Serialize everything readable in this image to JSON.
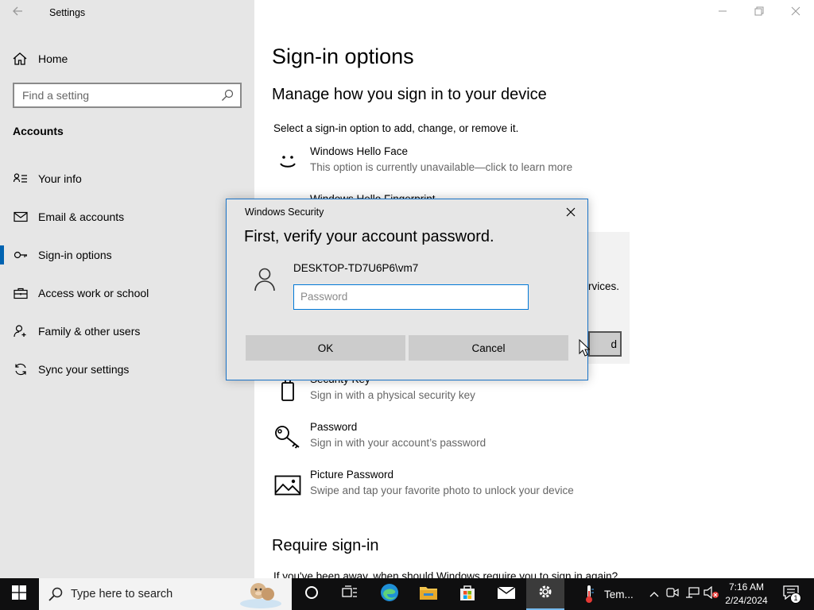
{
  "window": {
    "title": "Settings",
    "controls": {
      "minimize": "minimize",
      "maximize": "maximize",
      "close": "close"
    }
  },
  "sidebar": {
    "home_label": "Home",
    "search_placeholder": "Find a setting",
    "section_heading": "Accounts",
    "items": [
      {
        "label": "Your info",
        "icon": "person-list-icon",
        "active": false
      },
      {
        "label": "Email & accounts",
        "icon": "mail-icon",
        "active": false
      },
      {
        "label": "Sign-in options",
        "icon": "key-icon",
        "active": true
      },
      {
        "label": "Access work or school",
        "icon": "briefcase-icon",
        "active": false
      },
      {
        "label": "Family & other users",
        "icon": "add-person-icon",
        "active": false
      },
      {
        "label": "Sync your settings",
        "icon": "sync-icon",
        "active": false
      }
    ]
  },
  "main": {
    "page_title": "Sign-in options",
    "subtitle": "Manage how you sign in to your device",
    "description": "Select a sign-in option to add, change, or remove it.",
    "options": [
      {
        "title": "Windows Hello Face",
        "desc": "This option is currently unavailable—click to learn more",
        "icon": "smiley-icon"
      },
      {
        "title": "Windows Hello Fingerprint",
        "desc": "",
        "icon": "fingerprint-icon"
      },
      {
        "title": "Security Key",
        "desc": "Sign in with a physical security key",
        "icon": "usb-key-icon"
      },
      {
        "title": "Password",
        "desc": "Sign in with your account’s password",
        "icon": "key-icon"
      },
      {
        "title": "Picture Password",
        "desc": "Swipe and tap your favorite photo to unlock your device",
        "icon": "picture-icon"
      }
    ],
    "peek_text": "rvices.",
    "peek_button": "d",
    "section2_title": "Require sign-in",
    "section2_text": "If you've been away, when should Windows require you to sign in again?"
  },
  "dialog": {
    "title": "Windows Security",
    "heading": "First, verify your account password.",
    "username": "DESKTOP-TD7U6P6\\vm7",
    "password_placeholder": "Password",
    "password_value": "",
    "ok_label": "OK",
    "cancel_label": "Cancel"
  },
  "taskbar": {
    "search_placeholder": "Type here to search",
    "apps": [
      "cortana-icon",
      "task-view-icon",
      "edge-icon",
      "file-explorer-icon",
      "store-icon",
      "mail-icon",
      "settings-icon"
    ],
    "weather_label": "Tem...",
    "time": "7:16 AM",
    "date": "2/24/2024",
    "notification_count": "1"
  }
}
